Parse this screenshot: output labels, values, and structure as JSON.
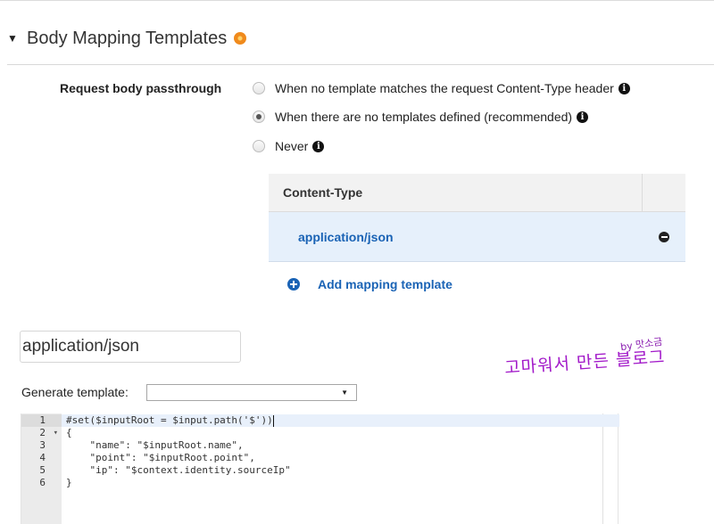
{
  "section": {
    "title": "Body Mapping Templates",
    "caret_icon": "caret-down-icon",
    "status_icon": "orange-indicator-icon"
  },
  "passthrough": {
    "label": "Request body passthrough",
    "options": [
      {
        "label": "When no template matches the request Content-Type header",
        "checked": false
      },
      {
        "label": "When there are no templates defined (recommended)",
        "checked": true
      },
      {
        "label": "Never",
        "checked": false
      }
    ]
  },
  "content_types": {
    "header": "Content-Type",
    "rows": [
      "application/json"
    ]
  },
  "add_template_label": "Add mapping template",
  "template_name_value": "application/json",
  "watermark": {
    "by": "by 맛소금",
    "main": "고마워서 만든 블로그"
  },
  "generate": {
    "label": "Generate template:",
    "selected": ""
  },
  "editor": {
    "lines": [
      {
        "num": "1",
        "code": "#set($inputRoot = $input.path('$'))"
      },
      {
        "num": "2",
        "code": "{",
        "fold": "▾"
      },
      {
        "num": "3",
        "code": "    \"name\": \"$inputRoot.name\","
      },
      {
        "num": "4",
        "code": "    \"point\": \"$inputRoot.point\","
      },
      {
        "num": "5",
        "code": "    \"ip\": \"$context.identity.sourceIp\""
      },
      {
        "num": "6",
        "code": "}"
      }
    ]
  },
  "colors": {
    "accent_blue": "#1a63b5",
    "selected_row": "#e6f0fb",
    "watermark": "#a219c9"
  }
}
